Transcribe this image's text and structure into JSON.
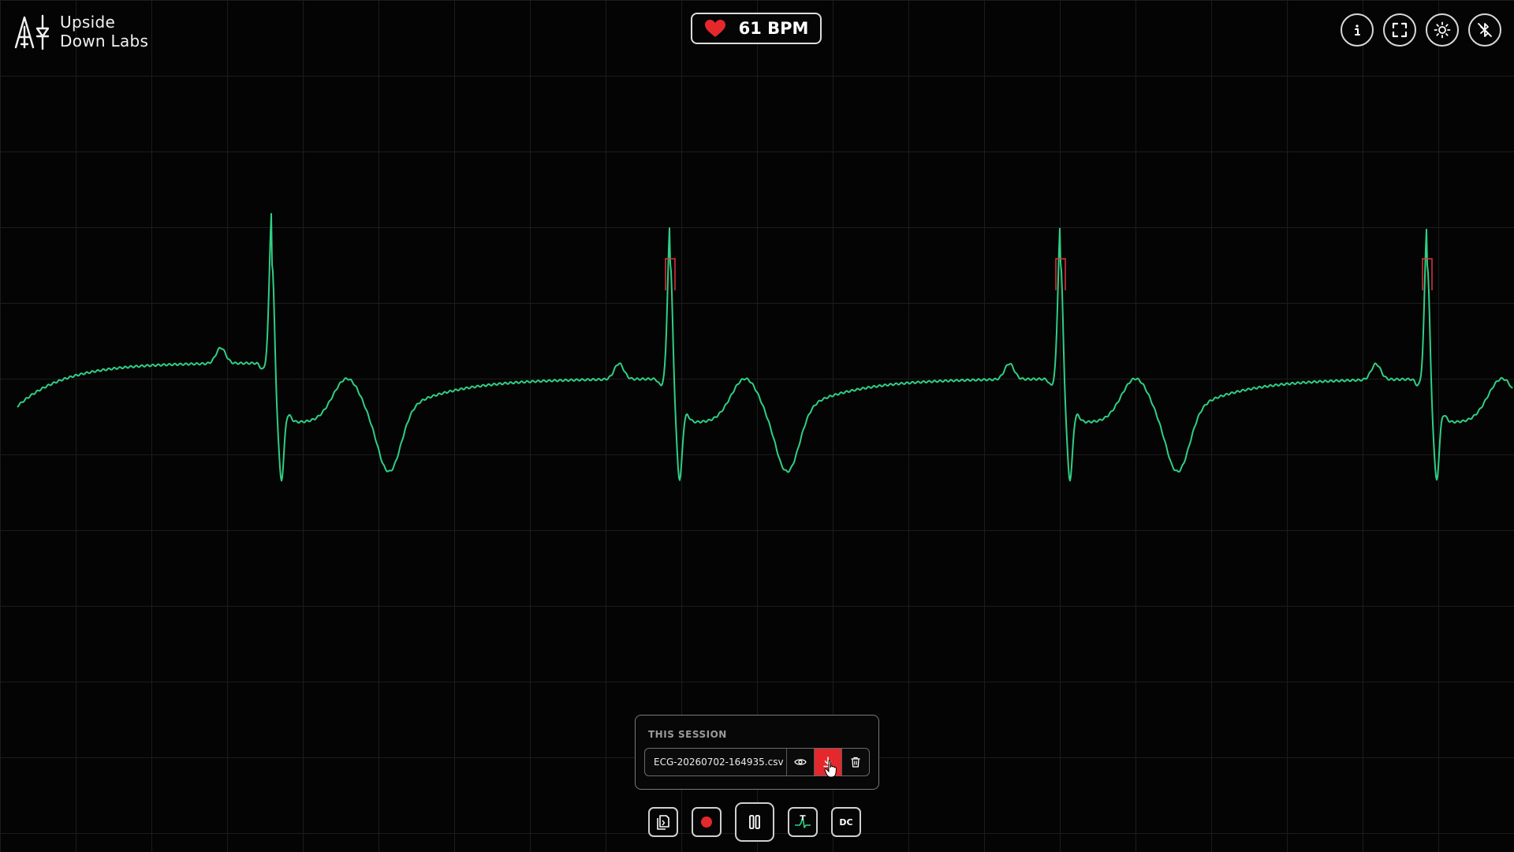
{
  "brand": {
    "line1": "Upside",
    "line2": "Down Labs"
  },
  "heart_rate": {
    "value": "61 BPM",
    "icon": "heart-icon"
  },
  "top_buttons": [
    {
      "name": "info-button",
      "icon": "info-icon"
    },
    {
      "name": "fullscreen-button",
      "icon": "fullscreen-icon"
    },
    {
      "name": "theme-button",
      "icon": "sun-icon"
    },
    {
      "name": "bluetooth-button",
      "icon": "bluetooth-off-icon"
    }
  ],
  "session": {
    "title": "THIS SESSION",
    "file_name": "ECG-20260702-164935.csv",
    "actions": [
      "view-icon",
      "download-icon",
      "trash-icon"
    ]
  },
  "controls": {
    "dc_label": "DC",
    "buttons": [
      "files-icon",
      "record-icon",
      "pause-icon",
      "ecg-filter-icon",
      "dc-icon"
    ]
  },
  "colors": {
    "signal": "#2fcf84",
    "peak_marker": "#e0353a",
    "accent": "#e5282c",
    "grid": "#1c1c1c"
  }
}
